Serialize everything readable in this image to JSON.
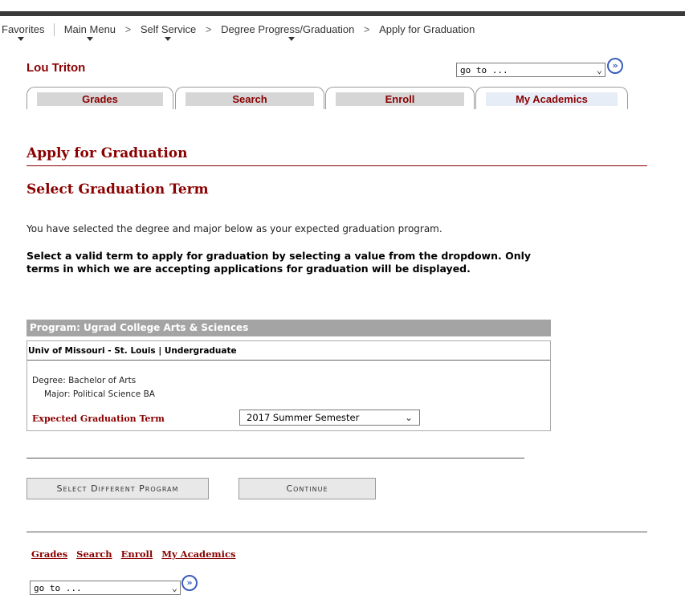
{
  "breadcrumb": {
    "favorites": "Favorites",
    "main_menu": "Main Menu",
    "self_service": "Self Service",
    "degree_progress": "Degree Progress/Graduation",
    "apply": "Apply for Graduation",
    "separator": ">"
  },
  "student_name": "Lou Triton",
  "goto": {
    "value": "go to ...",
    "button_icon": "»"
  },
  "tabs": [
    {
      "label": "Grades"
    },
    {
      "label": "Search"
    },
    {
      "label": "Enroll"
    },
    {
      "label": "My Academics"
    }
  ],
  "page_title": "Apply for Graduation",
  "section_title": "Select Graduation Term",
  "intro_text": "You have selected the degree and major below as your expected graduation program.",
  "instructions": "Select a valid term to apply for graduation by selecting a value from the dropdown. Only terms in which we are accepting applications for graduation will be displayed.",
  "program": {
    "header": "Program: Ugrad College Arts & Sciences",
    "career": "Univ of Missouri - St. Louis | Undergraduate",
    "degree": "Degree: Bachelor of Arts",
    "major": "Major: Political Science BA",
    "term_label": "Expected Graduation Term",
    "term_value": "2017 Summer Semester"
  },
  "buttons": {
    "select_different": "Select Different Program",
    "continue": "Continue"
  },
  "bottom_links": [
    "Grades",
    "Search",
    "Enroll",
    "My Academics"
  ],
  "icons": {
    "dropdown": "chevron-down-icon",
    "go": "double-chevron-right-icon"
  },
  "colors": {
    "accent": "#8b0000",
    "header_gray": "#a4a4a4",
    "tab_gray": "#d6d6d6"
  }
}
